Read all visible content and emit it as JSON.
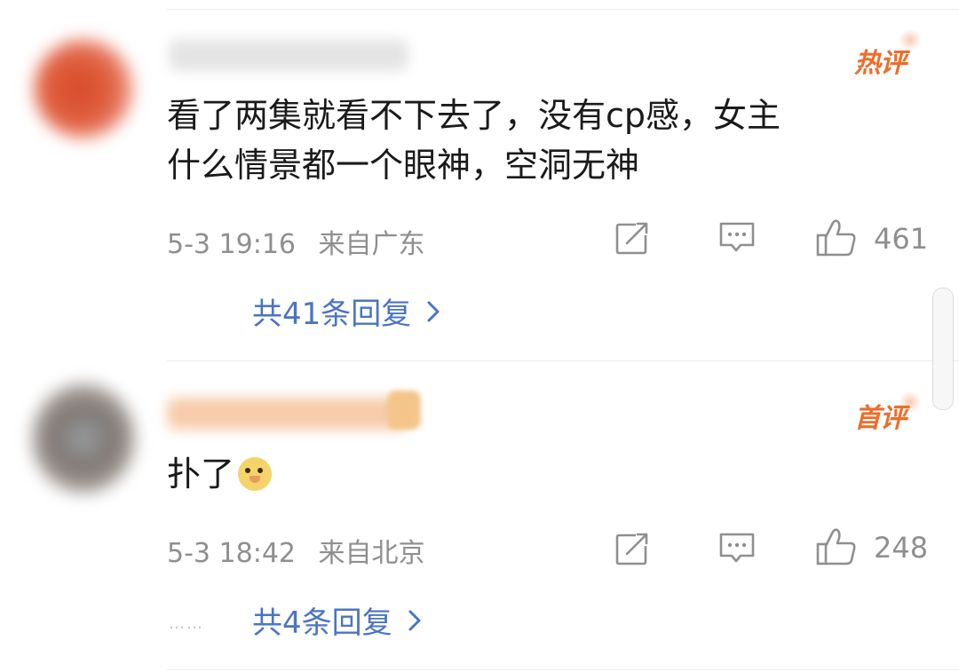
{
  "comments": [
    {
      "tag": "热评",
      "text_line1": "看了两集就看不下去了，没有cp感，女主",
      "text_line2": "什么情景都一个眼神，空洞无神",
      "date": "5-3 19:16",
      "location": "来自广东",
      "likes": "461",
      "replies_label": "共41条回复",
      "colors": {
        "tag": "#ee6d2a",
        "avatar": "#d64a28"
      }
    },
    {
      "tag": "首评",
      "text": "扑了",
      "emoji": "doge-emoji",
      "date": "5-3 18:42",
      "location": "来自北京",
      "likes": "248",
      "replies_label": "共4条回复",
      "dots": "……",
      "colors": {
        "tag": "#ee6d2a",
        "avatar": "#8a8380"
      }
    }
  ],
  "icons": {
    "share": "share-icon",
    "comment": "comment-icon",
    "like": "thumbs-up-icon",
    "more": "chevron-right-icon"
  },
  "colors": {
    "link": "#4a74c4",
    "meta": "#8f8f8f",
    "text": "#1a1a1a",
    "divider": "#ececec"
  }
}
